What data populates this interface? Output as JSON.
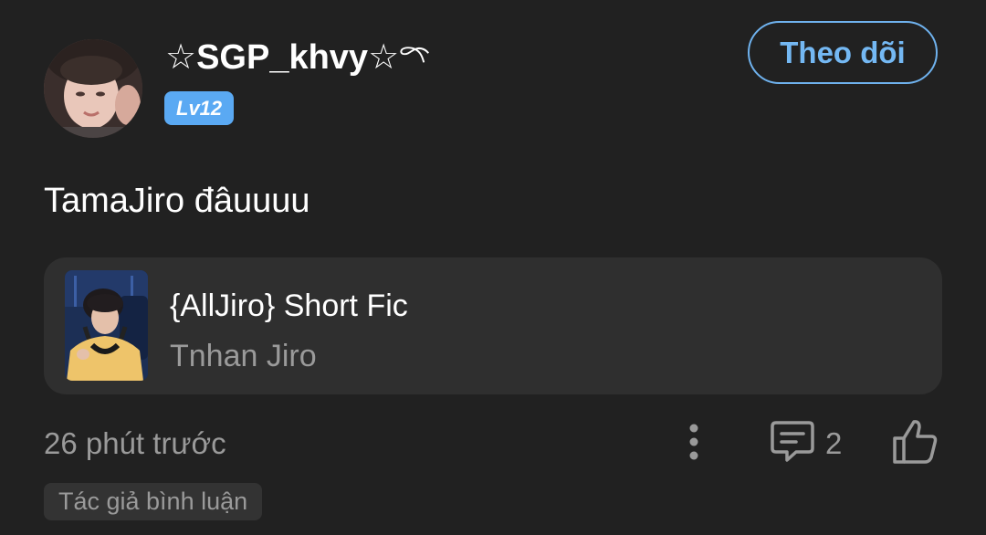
{
  "post": {
    "username": "☆SGP_khvy☆𓍼",
    "level": "Lv12",
    "follow_label": "Theo dõi",
    "text": "TamaJiro đâuuuu",
    "story": {
      "title": "{AllJiro} Short Fic",
      "author": "Tnhan Jiro"
    },
    "timestamp": "26 phút trước",
    "comment_count": "2",
    "author_comment_badge": "Tác giả bình luận"
  },
  "icons": {
    "more": "more-vertical-icon",
    "comment": "comment-icon",
    "like": "thumbs-up-icon"
  },
  "colors": {
    "background": "#212121",
    "card": "#2f2f2f",
    "accent": "#74b8f3",
    "badge": "#5aa9f3",
    "muted_text": "#9a9a9a"
  }
}
